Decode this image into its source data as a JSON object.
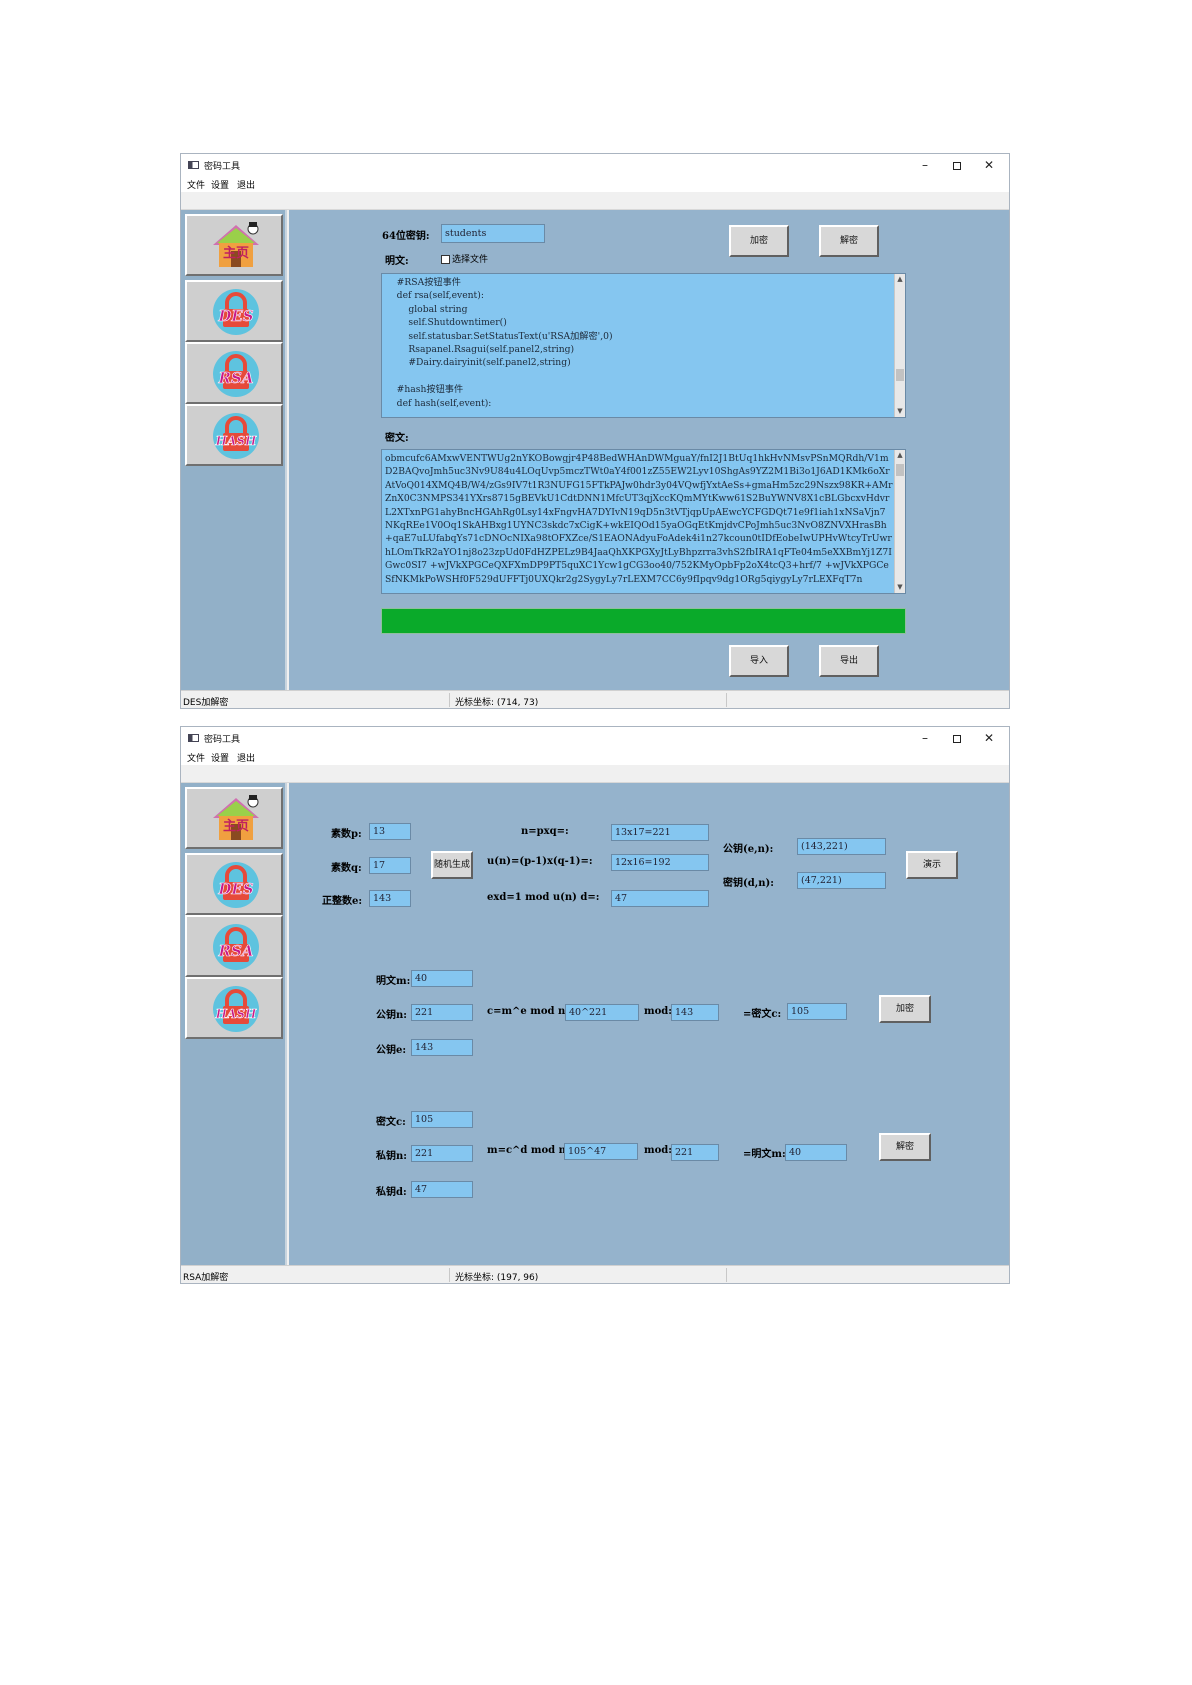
{
  "app": {
    "title": "密码工具",
    "menu": [
      "文件",
      "设置",
      "退出"
    ],
    "nav": [
      {
        "name": "home",
        "label": "主页"
      },
      {
        "name": "des",
        "label": "DES"
      },
      {
        "name": "rsa",
        "label": "RSA"
      },
      {
        "name": "hash",
        "label": "HASH"
      }
    ]
  },
  "des_window": {
    "key_label": "64位密钥:",
    "key_value": "students",
    "plaintext_label": "明文:",
    "checkbox_label": "选择文件",
    "encrypt_button": "加密",
    "decrypt_button": "解密",
    "plaintext_code": "    #RSA按钮事件\n    def rsa(self,event):\n        global string\n        self.Shutdowntimer()\n        self.statusbar.SetStatusText(u'RSA加解密',0)\n        Rsapanel.Rsagui(self.panel2,string)\n        #Dairy.dairyinit(self.panel2,string)\n\n    #hash按钮事件\n    def hash(self,event):",
    "ciphertext_label": "密文:",
    "ciphertext_text": "obmcufc6AMxwVENTWUg2nYKOBowgjr4P48BedWHAnDWMguaY/fnI2J1BtUq1hkHvNMsvPSnMQRdh/V1mD2BAQvoJmh5uc3Nv9U84u4LOqUvp5mczTWt0aY4f001zZ55EW2Lyv10ShgAs9YZ2M1Bi3o1J6AD1KMk6oXrAtVoQ014XMQ4B/W4/zGs9IV7t1R3NUFG15FTkPAJw0hdr3y04VQwfjYxtAeSs+gmaHm5zc29Nszx98KR+AMrZnX0C3NMPS341YXrs8715gBEVkU1CdtDNN1MfcUT3qjXccKQmMYtKww61S2BuYWNV8X1cBLGbcxvHdvrL2XTxnPG1ahyBncHGAhRg0Lsy14xFngvHA7DYIvN19qD5n3tVTjqpUpAEwcYCFGDQt71e9f1iah1xNSaVjn7NKqREe1V0Oq1SkAHBxg1UYNC3skdc7xCigK+wkEIQOd15yaOGqEtKmjdvCPoJmh5uc3NvO8ZNVXHrasBh+qaE7uLUfabqYs71cDNOcNIXa98tOFXZce/S1EAONAdyuFoAdek4i1n27kcoun0tIDfEobeIwUPHvWtcyTrUwrhLOmTkR2aYO1nj8o23zpUd0FdHZPELz9B4JaaQhXKPGXyJtLyBhpzrra3vhS2fbIRA1qFTe04m5eXXBmYj1Z7IGwc0SI7\n+wJVkXPGCeQXFXmDP9PT5quXC1Ycw1gCG3oo40/752KMyOpbFp2oX4tcQ3+hrf/7\n+wJVkXPGCeSfNKMkPoWSHf0F529dUFFTj0UXQkr2g2SygyLy7rLEXM7CC6y9fIpqv9dg1ORg5qiygyLy7rLEXFqT7n",
    "import_button": "导入",
    "export_button": "导出",
    "progress": 1.0,
    "status_left": "DES加解密",
    "status_coord": "光标坐标: (714, 73)"
  },
  "rsa_window": {
    "p_label": "素数p:",
    "p_value": "13",
    "q_label": "素数q:",
    "q_value": "17",
    "random_button": "随机生成",
    "e_label": "正整数e:",
    "e_value": "143",
    "n_label": "n=pxq=:",
    "n_value": "13x17=221",
    "un_label": "u(n)=(p-1)x(q-1)=:",
    "un_value": "12x16=192",
    "d_label": "exd=1 mod u(n) d=:",
    "d_value": "47",
    "pub_label": "公钥(e,n):",
    "pub_value": "(143,221)",
    "priv_label": "密钥(d,n):",
    "priv_value": "(47,221)",
    "demo_button": "演示",
    "enc_m_label": "明文m:",
    "enc_m_value": "40",
    "enc_n_label": "公钥n:",
    "enc_n_value": "221",
    "enc_e_label": "公钥e:",
    "enc_e_value": "143",
    "enc_formula_label": "c=m^e mod n:",
    "enc_formula_value": "40^221",
    "enc_mod_label": "mod:",
    "enc_mod_value": "143",
    "enc_result_label": "=密文c:",
    "enc_result_value": "105",
    "encrypt_button": "加密",
    "dec_c_label": "密文c:",
    "dec_c_value": "105",
    "dec_n_label": "私钥n:",
    "dec_n_value": "221",
    "dec_d_label": "私钥d:",
    "dec_d_value": "47",
    "dec_formula_label": "m=c^d mod n:",
    "dec_formula_value": "105^47",
    "dec_mod_label": "mod:",
    "dec_mod_value": "221",
    "dec_result_label": "=明文m:",
    "dec_result_value": "40",
    "decrypt_button": "解密",
    "status_left": "RSA加解密",
    "status_coord": "光标坐标: (197, 96)"
  }
}
